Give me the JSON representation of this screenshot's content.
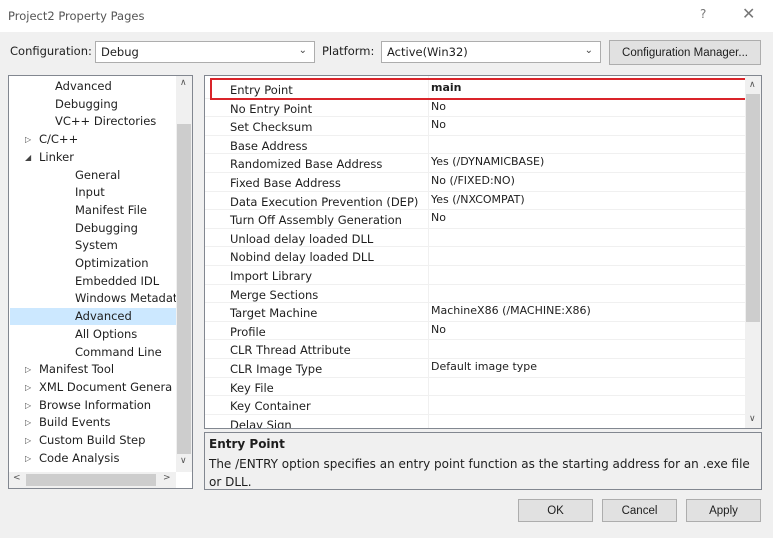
{
  "window": {
    "title": "Project2 Property Pages",
    "help": "?",
    "close": "✕"
  },
  "config": {
    "configuration_label": "Configuration:",
    "configuration_value": "Debug",
    "platform_label": "Platform:",
    "platform_value": "Active(Win32)",
    "manager_button": "Configuration Manager..."
  },
  "tree": {
    "items": [
      {
        "label": "Advanced",
        "level": 2,
        "expander": ""
      },
      {
        "label": "Debugging",
        "level": 2,
        "expander": ""
      },
      {
        "label": "VC++ Directories",
        "level": 2,
        "expander": ""
      },
      {
        "label": "C/C++",
        "level": 1,
        "expander": "▷"
      },
      {
        "label": "Linker",
        "level": 1,
        "expander": "◢"
      },
      {
        "label": "General",
        "level": 3,
        "expander": ""
      },
      {
        "label": "Input",
        "level": 3,
        "expander": ""
      },
      {
        "label": "Manifest File",
        "level": 3,
        "expander": ""
      },
      {
        "label": "Debugging",
        "level": 3,
        "expander": ""
      },
      {
        "label": "System",
        "level": 3,
        "expander": ""
      },
      {
        "label": "Optimization",
        "level": 3,
        "expander": ""
      },
      {
        "label": "Embedded IDL",
        "level": 3,
        "expander": ""
      },
      {
        "label": "Windows Metadata",
        "level": 3,
        "expander": ""
      },
      {
        "label": "Advanced",
        "level": 3,
        "expander": "",
        "selected": true
      },
      {
        "label": "All Options",
        "level": 3,
        "expander": ""
      },
      {
        "label": "Command Line",
        "level": 3,
        "expander": ""
      },
      {
        "label": "Manifest Tool",
        "level": 1,
        "expander": "▷"
      },
      {
        "label": "XML Document Genera",
        "level": 1,
        "expander": "▷"
      },
      {
        "label": "Browse Information",
        "level": 1,
        "expander": "▷"
      },
      {
        "label": "Build Events",
        "level": 1,
        "expander": "▷"
      },
      {
        "label": "Custom Build Step",
        "level": 1,
        "expander": "▷"
      },
      {
        "label": "Code Analysis",
        "level": 1,
        "expander": "▷"
      }
    ]
  },
  "properties": [
    {
      "name": "Entry Point",
      "value": "main",
      "highlighted": true
    },
    {
      "name": "No Entry Point",
      "value": "No"
    },
    {
      "name": "Set Checksum",
      "value": "No"
    },
    {
      "name": "Base Address",
      "value": ""
    },
    {
      "name": "Randomized Base Address",
      "value": "Yes (/DYNAMICBASE)"
    },
    {
      "name": "Fixed Base Address",
      "value": "No (/FIXED:NO)"
    },
    {
      "name": "Data Execution Prevention (DEP)",
      "value": "Yes (/NXCOMPAT)"
    },
    {
      "name": "Turn Off Assembly Generation",
      "value": "No"
    },
    {
      "name": "Unload delay loaded DLL",
      "value": ""
    },
    {
      "name": "Nobind delay loaded DLL",
      "value": ""
    },
    {
      "name": "Import Library",
      "value": ""
    },
    {
      "name": "Merge Sections",
      "value": ""
    },
    {
      "name": "Target Machine",
      "value": "MachineX86 (/MACHINE:X86)"
    },
    {
      "name": "Profile",
      "value": "No"
    },
    {
      "name": "CLR Thread Attribute",
      "value": ""
    },
    {
      "name": "CLR Image Type",
      "value": "Default image type"
    },
    {
      "name": "Key File",
      "value": ""
    },
    {
      "name": "Key Container",
      "value": ""
    },
    {
      "name": "Delay Sign",
      "value": ""
    }
  ],
  "description": {
    "title": "Entry Point",
    "text": "The /ENTRY option specifies an entry point function as the starting address for an .exe file or DLL."
  },
  "buttons": {
    "ok": "OK",
    "cancel": "Cancel",
    "apply": "Apply"
  },
  "colors": {
    "highlight_border": "#d9242a",
    "selection": "#cce8ff"
  }
}
